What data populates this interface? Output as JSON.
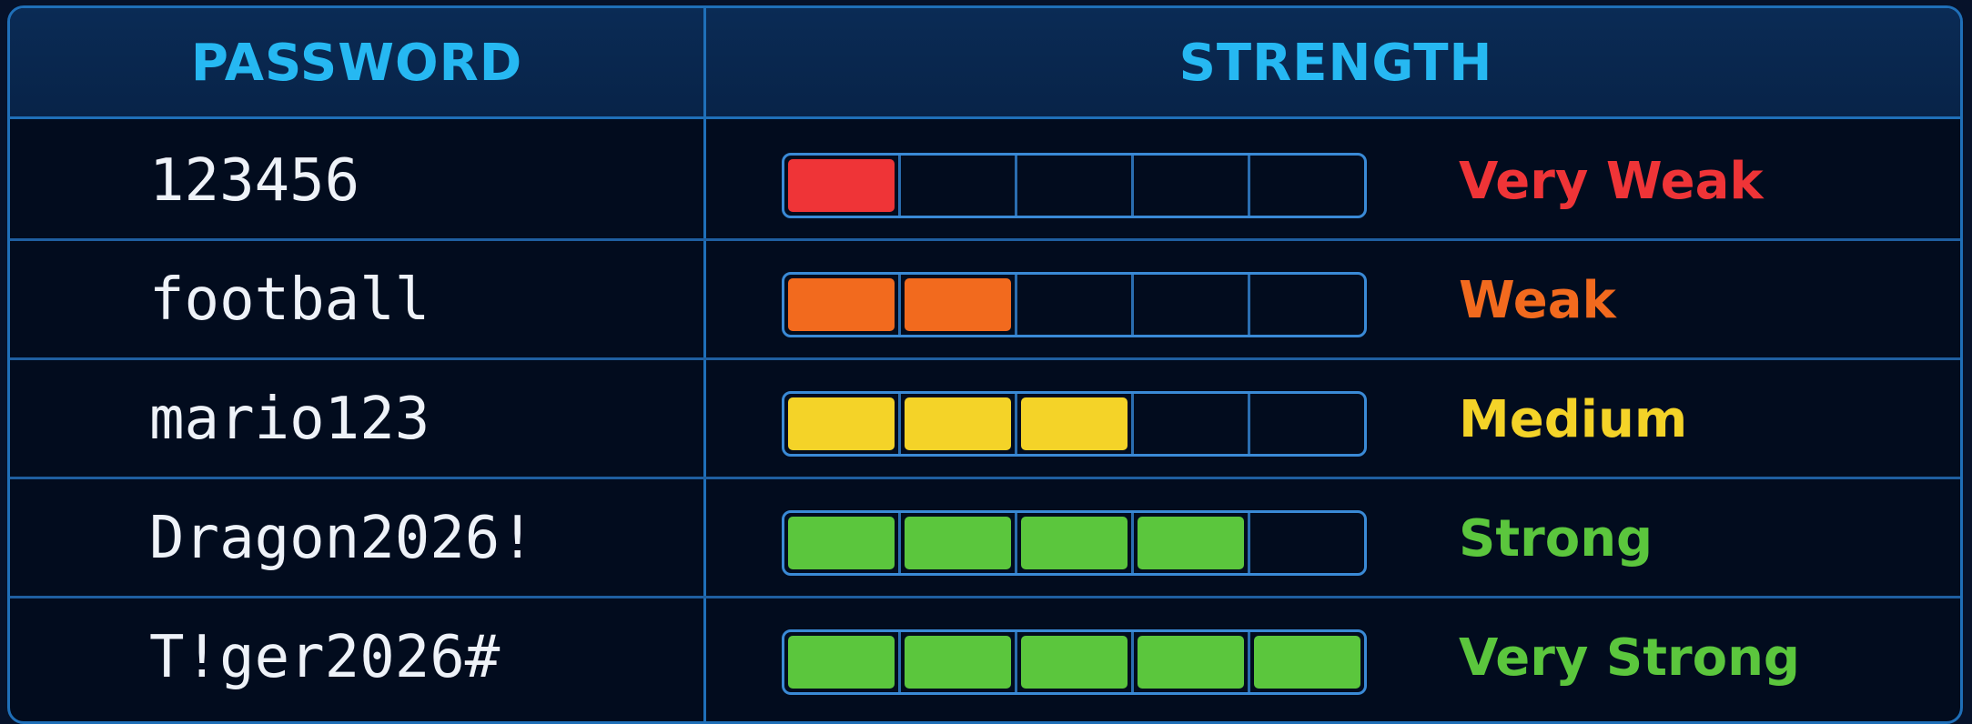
{
  "header": {
    "password_label": "PASSWORD",
    "strength_label": "STRENGTH"
  },
  "colors": {
    "very_weak": "#ef3437",
    "weak": "#f26a1e",
    "medium": "#f4d328",
    "strong": "#5bc63d",
    "very_strong": "#5bc63d"
  },
  "meter_segments": 5,
  "rows": [
    {
      "password": "123456",
      "strength": "Very Weak",
      "filled": 1,
      "color": "#ef3437"
    },
    {
      "password": "football",
      "strength": "Weak",
      "filled": 2,
      "color": "#f26a1e"
    },
    {
      "password": "mario123",
      "strength": "Medium",
      "filled": 3,
      "color": "#f4d328"
    },
    {
      "password": "Dragon2026!",
      "strength": "Strong",
      "filled": 4,
      "color": "#5bc63d"
    },
    {
      "password": "T!ger2026#",
      "strength": "Very Strong",
      "filled": 5,
      "color": "#5bc63d"
    }
  ]
}
